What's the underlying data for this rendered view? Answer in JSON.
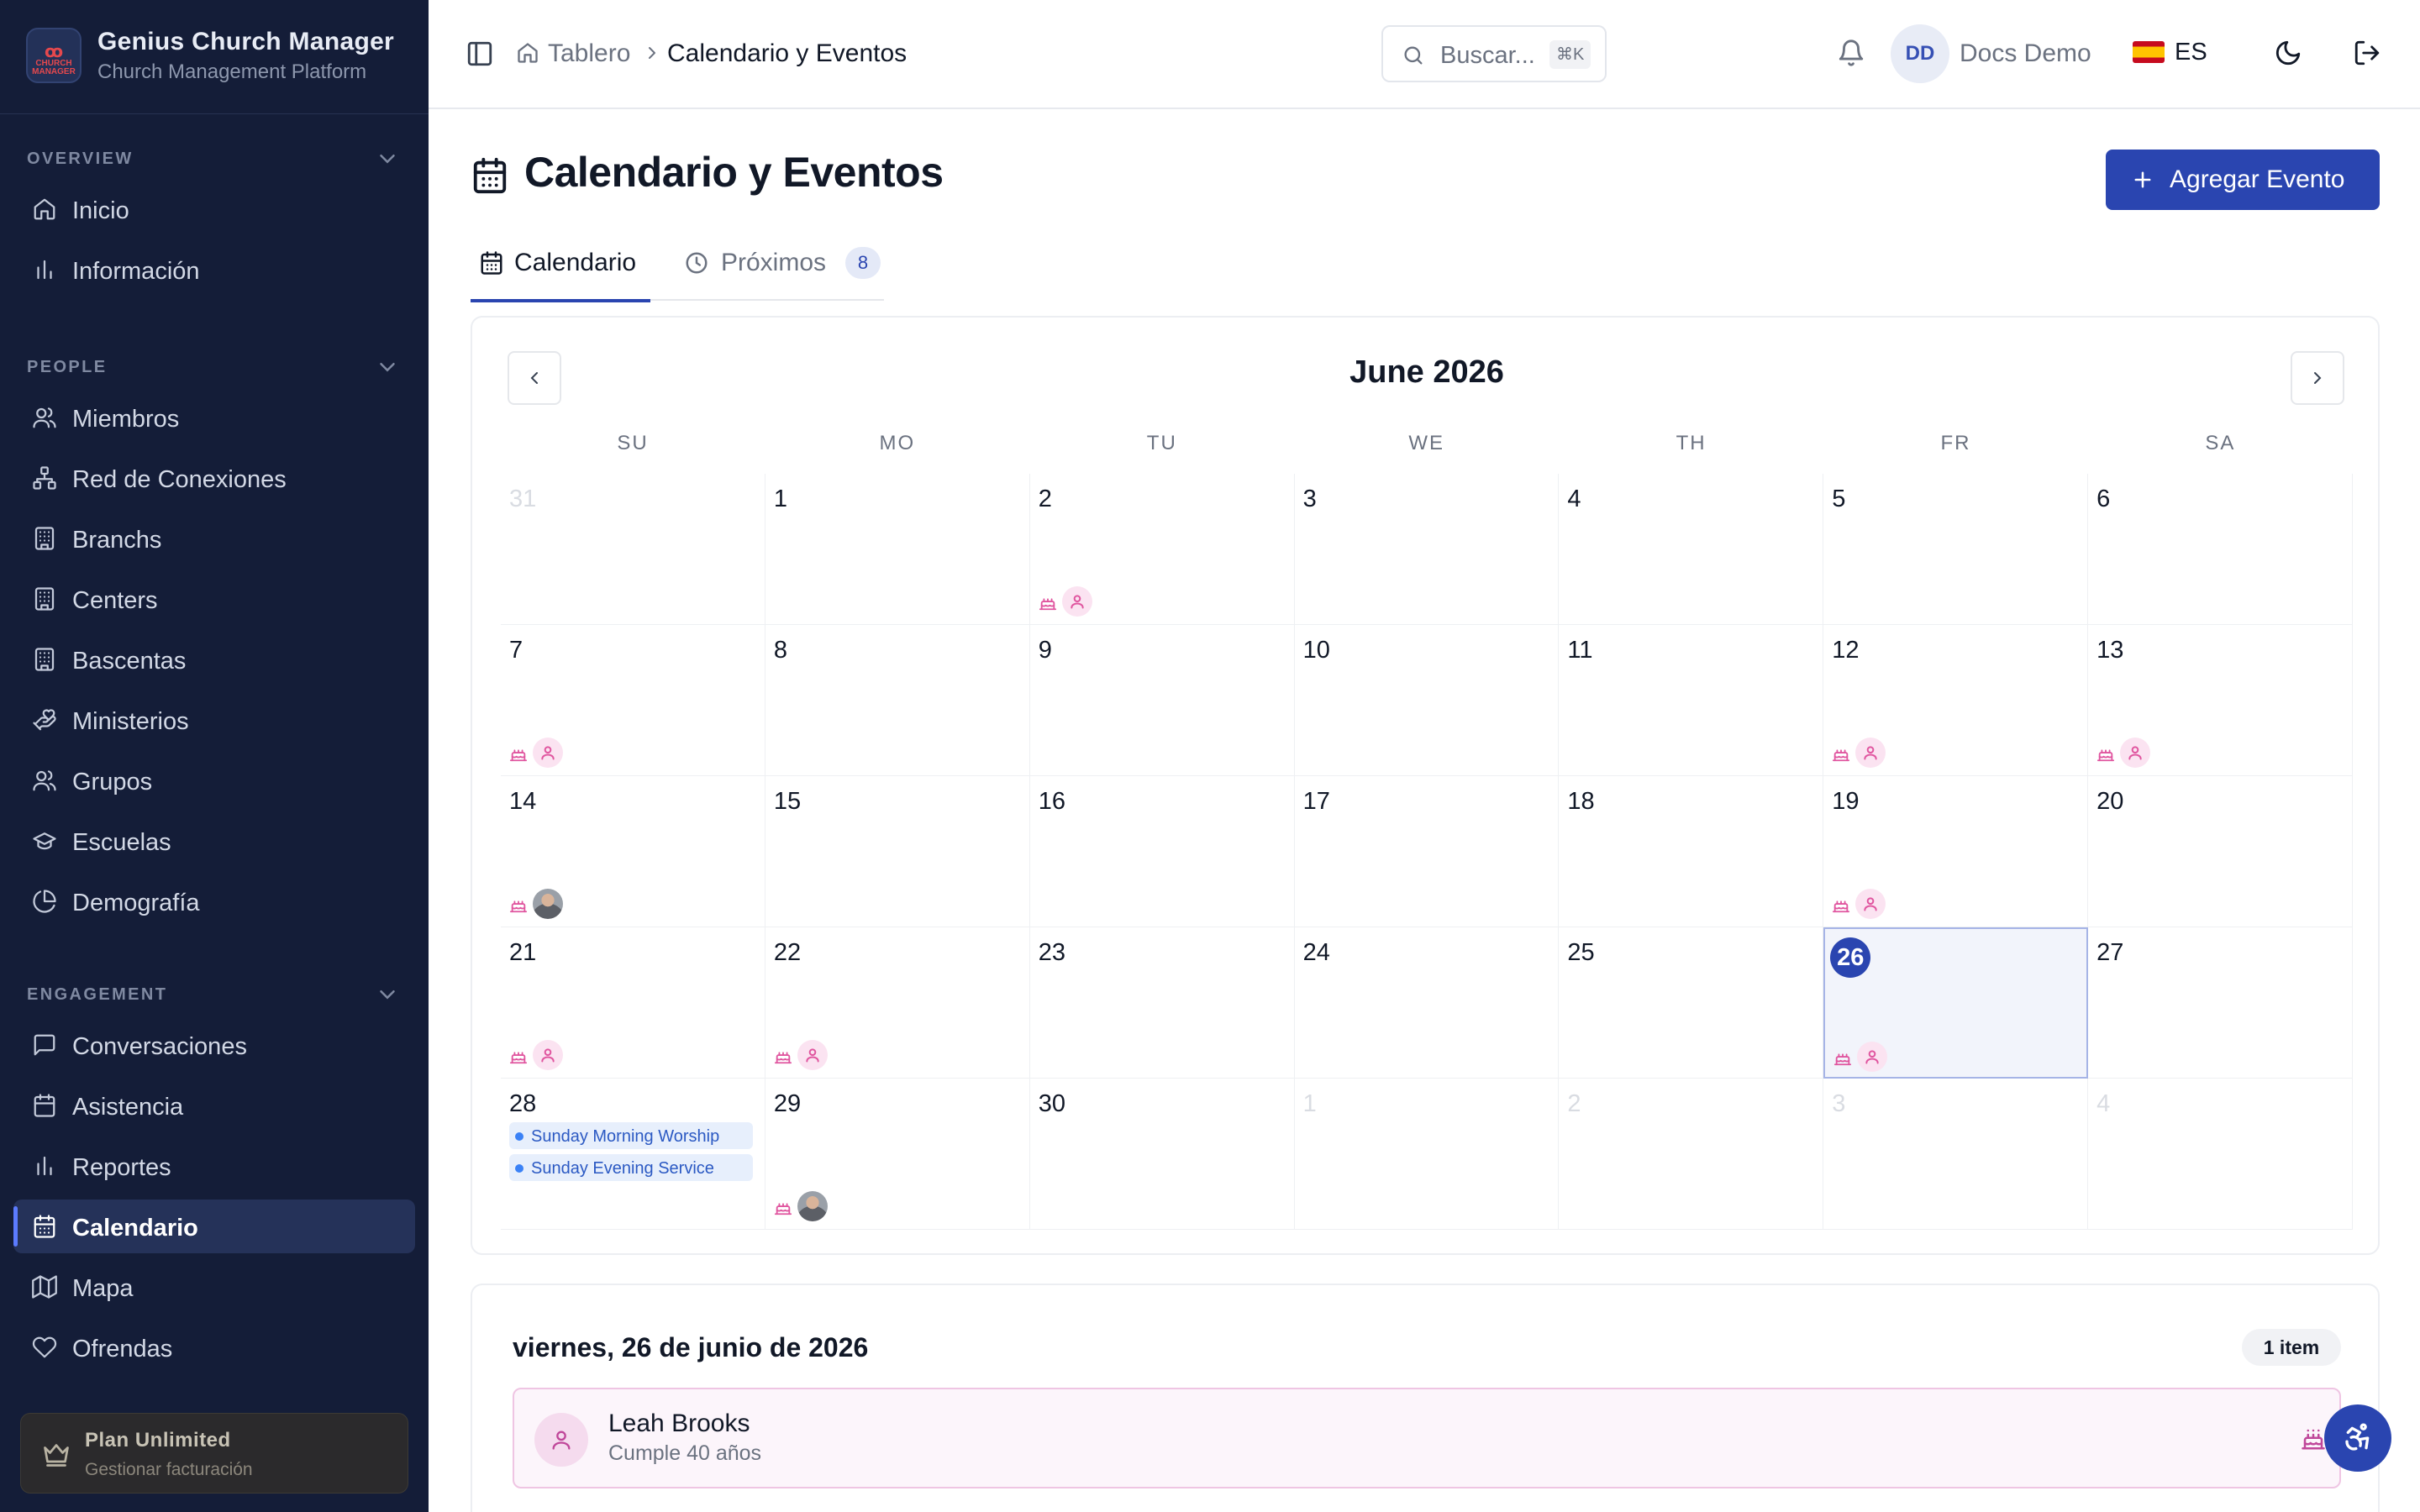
{
  "app": {
    "brand_title": "Genius Church Manager",
    "brand_subtitle": "Church Management Platform",
    "logo_text_top": "ꝏ",
    "logo_text_bottom": "CHURCH MANAGER"
  },
  "sidebar": {
    "sections": [
      {
        "title": "OVERVIEW",
        "items": [
          {
            "label": "Inicio",
            "icon": "home-icon"
          },
          {
            "label": "Información",
            "icon": "bar-chart-icon"
          }
        ]
      },
      {
        "title": "PEOPLE",
        "items": [
          {
            "label": "Miembros",
            "icon": "users-icon"
          },
          {
            "label": "Red de Conexiones",
            "icon": "network-icon"
          },
          {
            "label": "Branchs",
            "icon": "building-icon"
          },
          {
            "label": "Centers",
            "icon": "building-icon"
          },
          {
            "label": "Bascentas",
            "icon": "building-icon"
          },
          {
            "label": "Ministerios",
            "icon": "hand-heart-icon"
          },
          {
            "label": "Grupos",
            "icon": "users-icon"
          },
          {
            "label": "Escuelas",
            "icon": "graduation-cap-icon"
          },
          {
            "label": "Demografía",
            "icon": "pie-chart-icon"
          }
        ]
      },
      {
        "title": "ENGAGEMENT",
        "items": [
          {
            "label": "Conversaciones",
            "icon": "message-icon"
          },
          {
            "label": "Asistencia",
            "icon": "calendar-check-icon"
          },
          {
            "label": "Reportes",
            "icon": "bar-chart-icon"
          },
          {
            "label": "Calendario",
            "icon": "calendar-icon",
            "active": true
          },
          {
            "label": "Mapa",
            "icon": "map-icon"
          },
          {
            "label": "Ofrendas",
            "icon": "heart-icon"
          }
        ]
      }
    ],
    "plan": {
      "title": "Plan Unlimited",
      "subtitle": "Gestionar facturación"
    }
  },
  "topbar": {
    "breadcrumb": [
      "Tablero",
      "Calendario y Eventos"
    ],
    "search_placeholder": "Buscar...",
    "search_shortcut": "⌘K",
    "user_initials": "DD",
    "user_name": "Docs Demo",
    "language": "ES"
  },
  "page": {
    "title": "Calendario y Eventos",
    "add_button": "Agregar Evento",
    "tabs": [
      {
        "label": "Calendario",
        "active": true
      },
      {
        "label": "Próximos",
        "badge": "8"
      }
    ]
  },
  "calendar": {
    "month_label": "June 2026",
    "weekdays": [
      "SU",
      "MO",
      "TU",
      "WE",
      "TH",
      "FR",
      "SA"
    ],
    "today": 26,
    "weeks": [
      [
        {
          "d": "31",
          "out": true
        },
        {
          "d": "1"
        },
        {
          "d": "2",
          "mark": "birthday"
        },
        {
          "d": "3"
        },
        {
          "d": "4"
        },
        {
          "d": "5"
        },
        {
          "d": "6"
        }
      ],
      [
        {
          "d": "7",
          "mark": "birthday"
        },
        {
          "d": "8"
        },
        {
          "d": "9"
        },
        {
          "d": "10"
        },
        {
          "d": "11"
        },
        {
          "d": "12",
          "mark": "birthday"
        },
        {
          "d": "13",
          "mark": "birthday"
        }
      ],
      [
        {
          "d": "14",
          "mark": "birthday-photo"
        },
        {
          "d": "15"
        },
        {
          "d": "16"
        },
        {
          "d": "17"
        },
        {
          "d": "18"
        },
        {
          "d": "19",
          "mark": "birthday"
        },
        {
          "d": "20"
        }
      ],
      [
        {
          "d": "21",
          "mark": "birthday"
        },
        {
          "d": "22",
          "mark": "birthday"
        },
        {
          "d": "23"
        },
        {
          "d": "24"
        },
        {
          "d": "25"
        },
        {
          "d": "26",
          "mark": "birthday",
          "today": true
        },
        {
          "d": "27"
        }
      ],
      [
        {
          "d": "28",
          "events": [
            "Sunday Morning Worship",
            "Sunday Evening Service"
          ]
        },
        {
          "d": "29",
          "mark": "birthday-photo"
        },
        {
          "d": "30"
        },
        {
          "d": "1",
          "out": true
        },
        {
          "d": "2",
          "out": true
        },
        {
          "d": "3",
          "out": true
        },
        {
          "d": "4",
          "out": true
        }
      ]
    ]
  },
  "day_detail": {
    "title": "viernes, 26 de junio de 2026",
    "count": "1 item",
    "items": [
      {
        "name": "Leah Brooks",
        "subtitle": "Cumple 40 años"
      }
    ]
  },
  "colors": {
    "accent": "#2a45b0",
    "sidebar_bg": "#141d38",
    "birthday_pink": "#e0559f",
    "event_blue": "#3b82f6"
  }
}
